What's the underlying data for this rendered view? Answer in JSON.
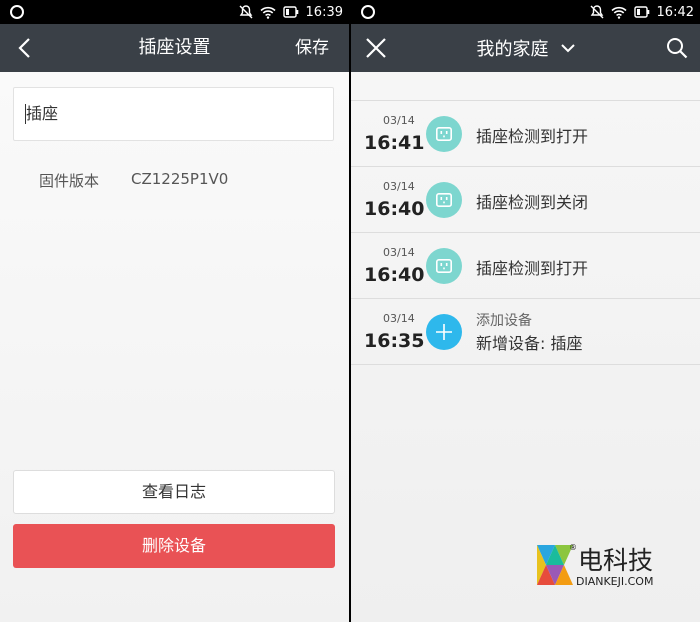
{
  "left": {
    "status": {
      "time": "16:39"
    },
    "header": {
      "title": "插座设置",
      "save_label": "保存"
    },
    "name_input": {
      "value": "插座"
    },
    "firmware": {
      "label": "固件版本",
      "value": "CZ1225P1V0"
    },
    "buttons": {
      "view_log": "查看日志",
      "delete_device": "删除设备"
    }
  },
  "right": {
    "status": {
      "time": "16:42"
    },
    "header": {
      "title": "我的家庭"
    },
    "feed": [
      {
        "date": "03/14",
        "time": "16:41",
        "text": "插座检测到打开",
        "icon": "socket-icon"
      },
      {
        "date": "03/14",
        "time": "16:40",
        "text": "插座检测到关闭",
        "icon": "socket-icon"
      },
      {
        "date": "03/14",
        "time": "16:40",
        "text": "插座检测到打开",
        "icon": "socket-icon"
      },
      {
        "date": "03/14",
        "time": "16:35",
        "title": "添加设备",
        "text": "新增设备: 插座",
        "icon": "plus-icon"
      }
    ]
  },
  "watermark": {
    "cn": "电科技",
    "en": "DIANKEJI.COM",
    "reg": "®"
  },
  "colors": {
    "appbar": "#3a4047",
    "danger": "#e95255",
    "socket_icon_bg": "#7dd6cf",
    "add_icon_bg": "#2eb8ec"
  }
}
